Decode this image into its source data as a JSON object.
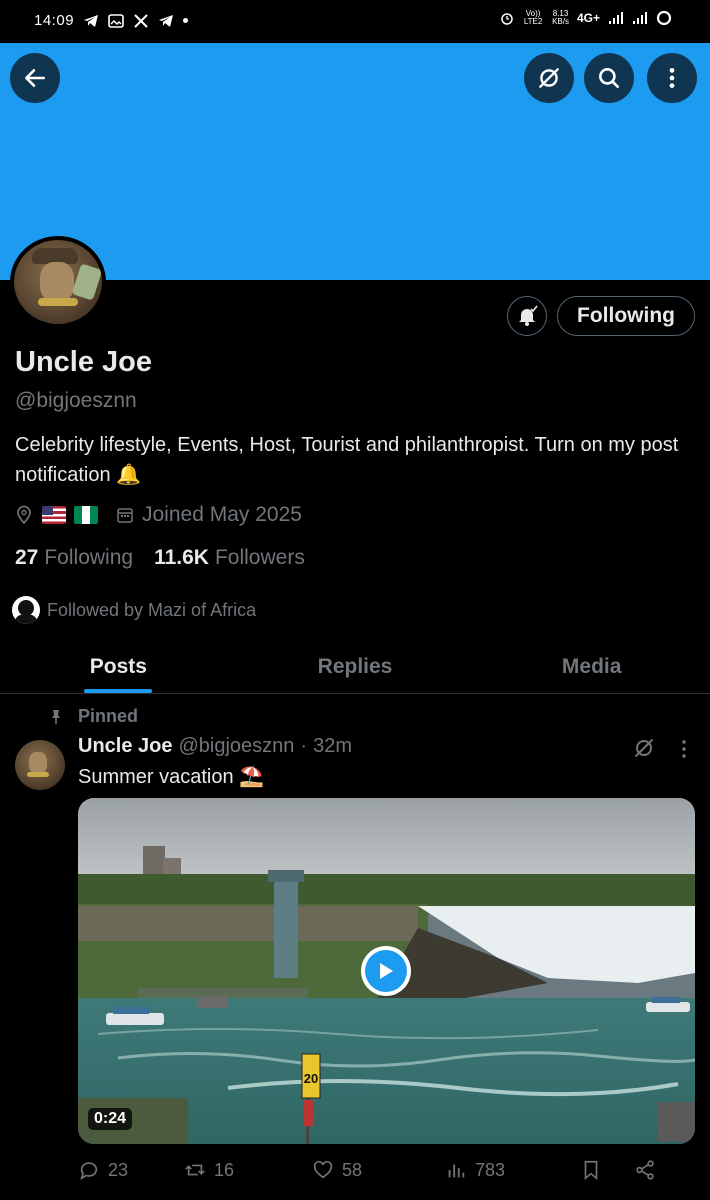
{
  "status_bar": {
    "time": "14:09",
    "volte_label": "Vo)) LTE2",
    "speed_value": "8.13",
    "speed_unit": "KB/s",
    "network": "4G+"
  },
  "header": {
    "back_icon": "arrow-left-icon",
    "grok_icon": "grok-icon",
    "search_icon": "search-icon",
    "more_icon": "more-vertical-icon",
    "banner_color": "#1d9bf0"
  },
  "profile": {
    "name": "Uncle Joe",
    "handle": "@bigjoesznn",
    "bio": "Celebrity lifestyle, Events, Host, Tourist and philanthropist. Turn on my post notification 🔔",
    "location_flags": [
      "🇺🇸",
      "🇳🇬"
    ],
    "joined": "Joined May 2025",
    "following_count": "27",
    "following_label": "Following",
    "followers_count": "11.6K",
    "followers_label": "Followers",
    "followed_by": "Followed by Mazi of Africa",
    "follow_button_label": "Following"
  },
  "tabs": [
    {
      "label": "Posts",
      "active": true
    },
    {
      "label": "Replies",
      "active": false
    },
    {
      "label": "Media",
      "active": false
    }
  ],
  "post": {
    "pinned_label": "Pinned",
    "author_name": "Uncle Joe",
    "author_handle": "@bigjoesznn",
    "separator": "·",
    "time": "32m",
    "text": "Summer vacation ⛱️",
    "video_duration": "0:24",
    "sign_text": "20",
    "replies": "23",
    "reposts": "16",
    "likes": "58",
    "views": "783"
  },
  "colors": {
    "accent": "#1d9bf0",
    "secondary_text": "#71767b",
    "primary_text": "#e7e9ea",
    "background": "#000000"
  }
}
